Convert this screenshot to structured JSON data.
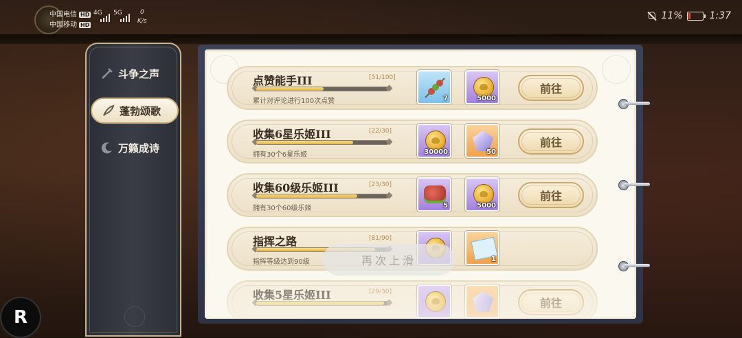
{
  "status_bar": {
    "carrier1": "中国电信",
    "carrier2": "中国移动",
    "hd": "HD",
    "net1": "4G",
    "net2": "5G",
    "speed_value": "0",
    "speed_unit": "K/s",
    "battery": "11%",
    "time": "1:37"
  },
  "sidebar": {
    "items": [
      {
        "label": "斗争之声",
        "icon": "sword-icon",
        "active": false
      },
      {
        "label": "蓬勃颂歌",
        "icon": "feather-icon",
        "active": true
      },
      {
        "label": "万籁成诗",
        "icon": "moon-icon",
        "active": false
      }
    ]
  },
  "tasks": [
    {
      "title": "点赞能手III",
      "progress_text": "[51/100]",
      "progress": 0.51,
      "desc": "累计对评论进行100次点赞",
      "rewards": [
        {
          "icon": "skewer-icon",
          "rarity": "blue",
          "qty": "7"
        },
        {
          "icon": "coin-icon",
          "rarity": "purple",
          "qty": "5000"
        }
      ],
      "button": "前往"
    },
    {
      "title": "收集6星乐姬III",
      "progress_text": "[22/30]",
      "progress": 0.733,
      "desc": "拥有30个6星乐姬",
      "rewards": [
        {
          "icon": "coin-icon",
          "rarity": "purple",
          "qty": "30000"
        },
        {
          "icon": "gem-icon",
          "rarity": "orange",
          "qty": "50"
        }
      ],
      "button": "前往"
    },
    {
      "title": "收集60级乐姬III",
      "progress_text": "[23/30]",
      "progress": 0.767,
      "desc": "拥有30个60级乐姬",
      "rewards": [
        {
          "icon": "meat-icon",
          "rarity": "purple",
          "qty": "5"
        },
        {
          "icon": "coin-icon",
          "rarity": "purple",
          "qty": "5000"
        }
      ],
      "button": "前往"
    },
    {
      "title": "指挥之路",
      "progress_text": "[81/90]",
      "progress": 0.9,
      "desc": "指挥等级达到90级",
      "rewards": [
        {
          "icon": "coin-icon",
          "rarity": "purple",
          "qty": ""
        },
        {
          "icon": "ticket-icon",
          "rarity": "orange",
          "qty": "1"
        }
      ],
      "button": ""
    },
    {
      "title": "收集5星乐姬III",
      "progress_text": "[29/30]",
      "progress": 0.967,
      "desc": "",
      "rewards": [
        {
          "icon": "coin-icon",
          "rarity": "purple",
          "qty": ""
        },
        {
          "icon": "gem-icon",
          "rarity": "orange",
          "qty": ""
        }
      ],
      "button": "前往"
    }
  ],
  "toast": "再次上滑",
  "floating_button": "R"
}
